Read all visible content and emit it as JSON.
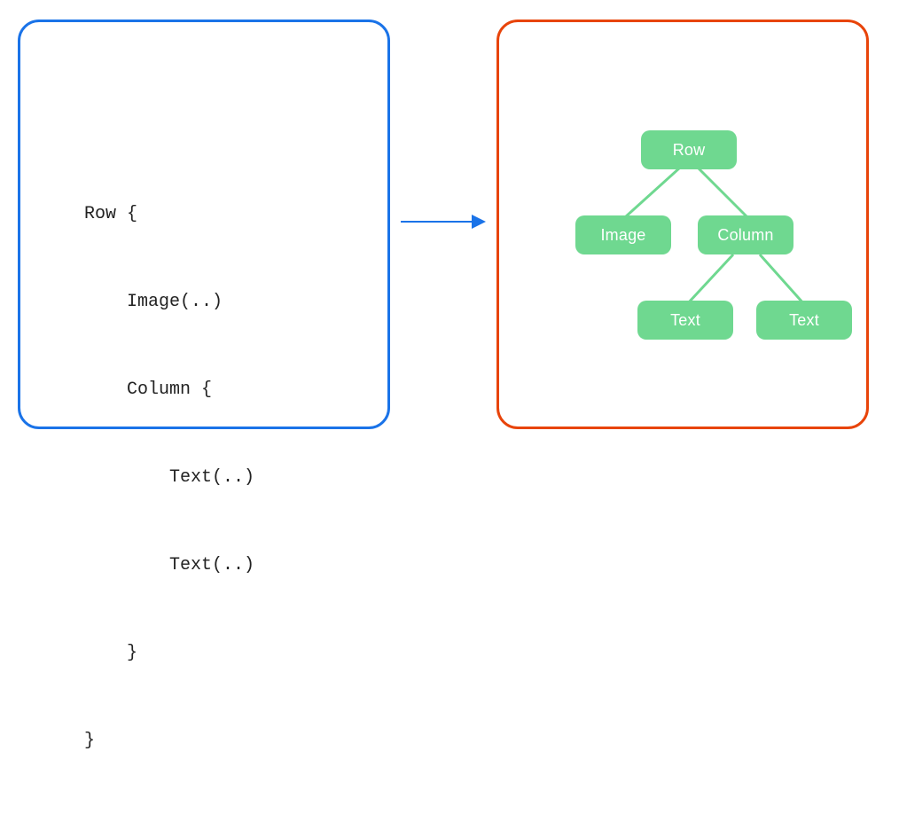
{
  "code": {
    "lines": [
      "Row {",
      "    Image(..)",
      "    Column {",
      "        Text(..)",
      "        Text(..)",
      "    }",
      "}"
    ]
  },
  "tree": {
    "root": "Row",
    "level2_left": "Image",
    "level2_right": "Column",
    "level3_left": "Text",
    "level3_right": "Text"
  },
  "colors": {
    "left_border": "#1a73e8",
    "right_border": "#e8440a",
    "arrow": "#1a73e8",
    "node_fill": "#6fd890",
    "node_text": "#ffffff"
  }
}
